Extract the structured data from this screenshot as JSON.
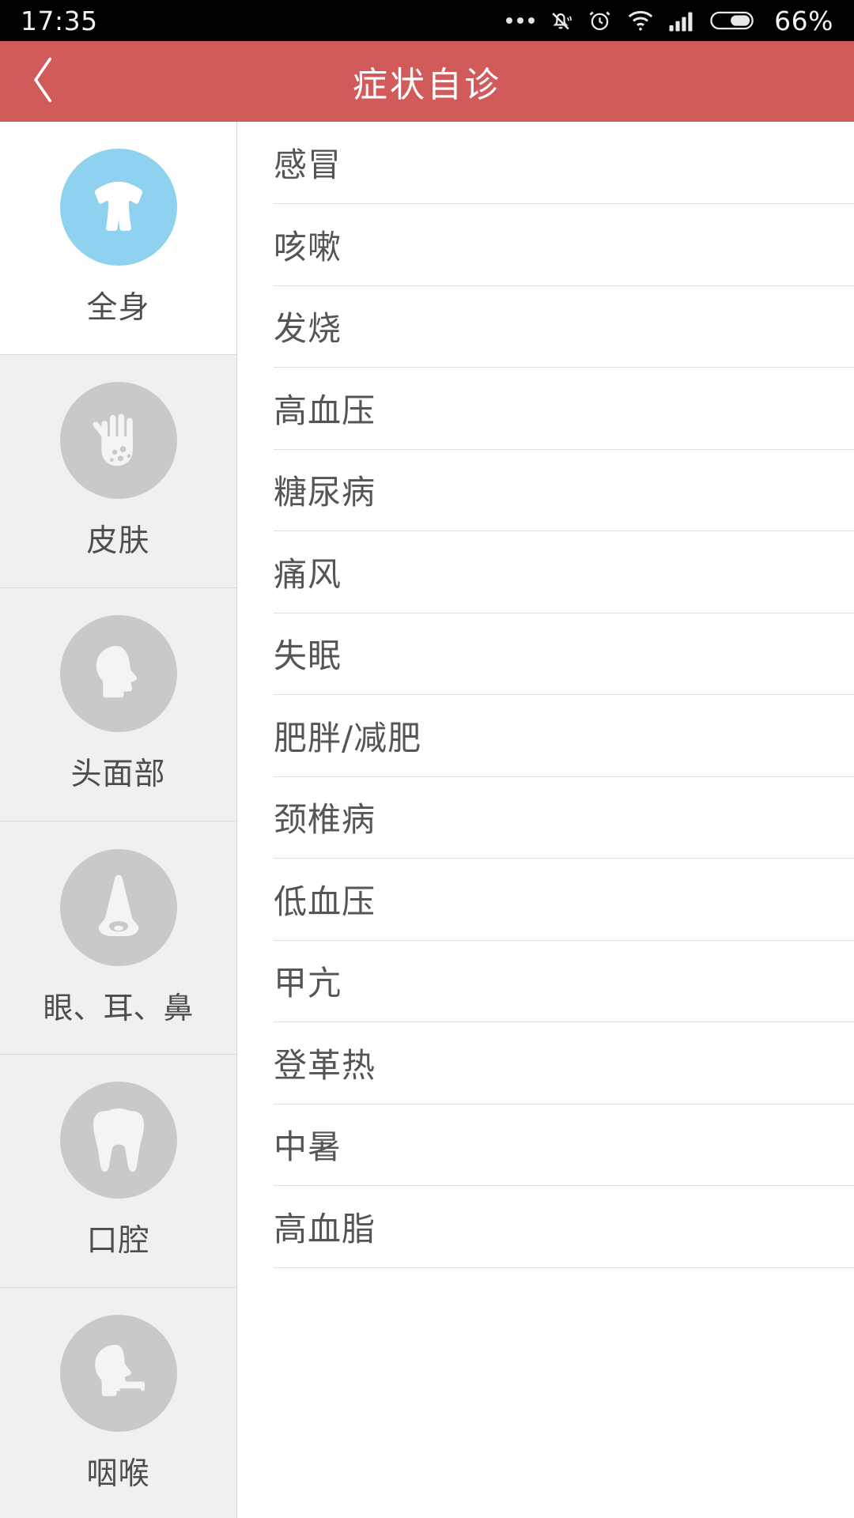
{
  "status_bar": {
    "time": "17:35",
    "battery_percent": "66%",
    "icons": [
      "more-dots-icon",
      "mute-bell-icon",
      "alarm-clock-icon",
      "wifi-icon",
      "cellular-signal-icon",
      "battery-icon"
    ]
  },
  "header": {
    "title": "症状自诊",
    "back_icon": "chevron-left-icon",
    "background_color": "#d15b5b"
  },
  "sidebar": {
    "selected_index": 0,
    "selected_icon_color": "#8ed2ef",
    "icon_color": "#c9c9c9",
    "items": [
      {
        "label": "全身",
        "icon": "torso-body-icon",
        "selected": true
      },
      {
        "label": "皮肤",
        "icon": "hand-skin-spots-icon",
        "selected": false
      },
      {
        "label": "头面部",
        "icon": "head-profile-icon",
        "selected": false
      },
      {
        "label": "眼、耳、鼻",
        "icon": "nose-icon",
        "selected": false
      },
      {
        "label": "口腔",
        "icon": "tooth-icon",
        "selected": false
      },
      {
        "label": "咽喉",
        "icon": "throat-head-icon",
        "selected": false
      }
    ]
  },
  "main_list": {
    "items": [
      {
        "label": "感冒"
      },
      {
        "label": "咳嗽"
      },
      {
        "label": "发烧"
      },
      {
        "label": "高血压"
      },
      {
        "label": "糖尿病"
      },
      {
        "label": "痛风"
      },
      {
        "label": "失眠"
      },
      {
        "label": "肥胖/减肥"
      },
      {
        "label": "颈椎病"
      },
      {
        "label": "低血压"
      },
      {
        "label": "甲亢"
      },
      {
        "label": "登革热"
      },
      {
        "label": "中暑"
      },
      {
        "label": "高血脂"
      }
    ]
  }
}
